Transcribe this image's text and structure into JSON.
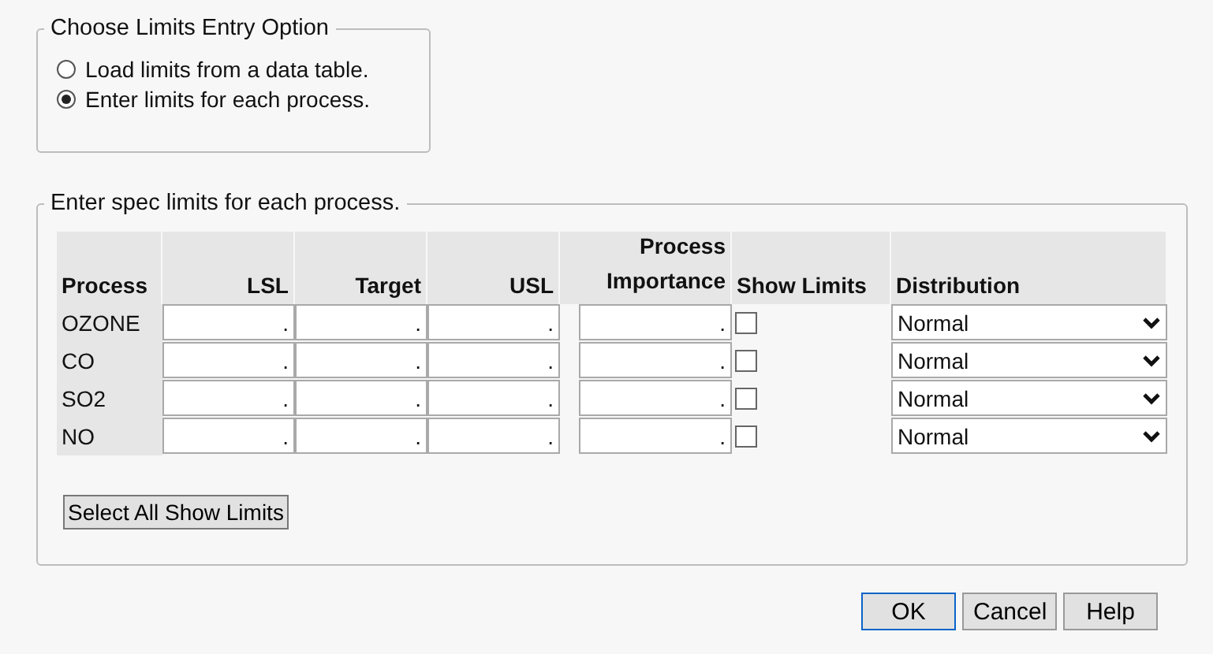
{
  "entry_option": {
    "legend": "Choose Limits Entry Option",
    "options": [
      {
        "label": "Load limits from a data table.",
        "selected": false
      },
      {
        "label": "Enter limits for each process.",
        "selected": true
      }
    ]
  },
  "spec_limits": {
    "legend": "Enter spec limits for each process.",
    "columns": {
      "process": "Process",
      "lsl": "LSL",
      "target": "Target",
      "usl": "USL",
      "importance_1": "Process",
      "importance_2": "Importance",
      "show_limits": "Show Limits",
      "distribution": "Distribution"
    },
    "rows": [
      {
        "process": "OZONE",
        "lsl": ".",
        "target": ".",
        "usl": ".",
        "importance": ".",
        "show_limits": false,
        "distribution": "Normal"
      },
      {
        "process": "CO",
        "lsl": ".",
        "target": ".",
        "usl": ".",
        "importance": ".",
        "show_limits": false,
        "distribution": "Normal"
      },
      {
        "process": "SO2",
        "lsl": ".",
        "target": ".",
        "usl": ".",
        "importance": ".",
        "show_limits": false,
        "distribution": "Normal"
      },
      {
        "process": "NO",
        "lsl": ".",
        "target": ".",
        "usl": ".",
        "importance": ".",
        "show_limits": false,
        "distribution": "Normal"
      }
    ],
    "select_all_button": "Select All Show Limits"
  },
  "buttons": [
    {
      "label": "OK",
      "kind": "default"
    },
    {
      "label": "Cancel",
      "kind": "normal"
    },
    {
      "label": "Help",
      "kind": "normal"
    }
  ]
}
